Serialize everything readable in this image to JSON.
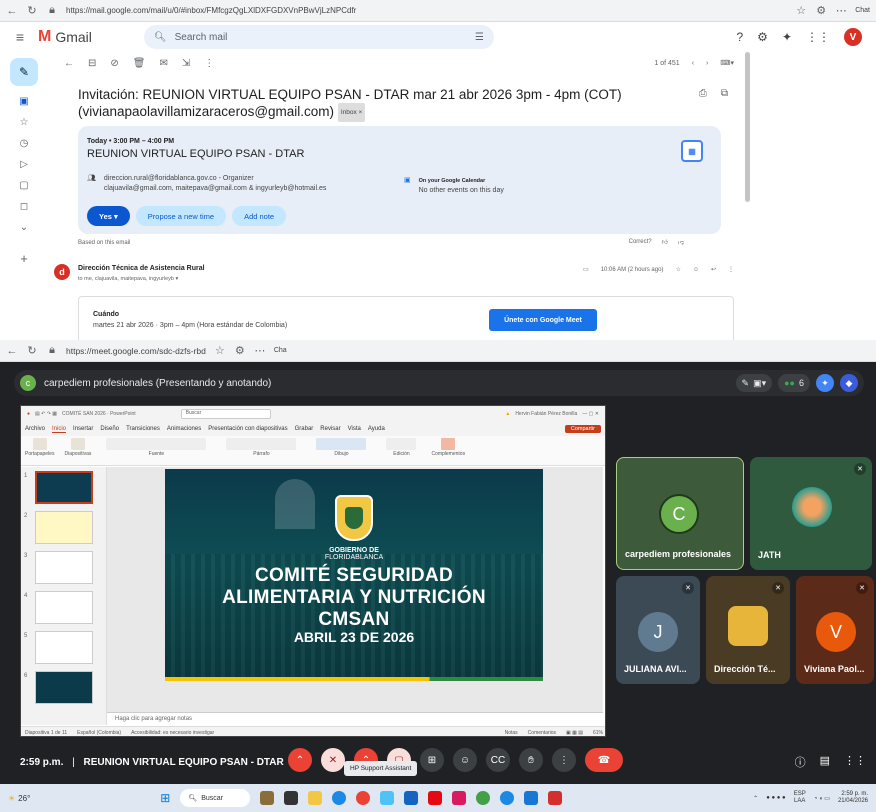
{
  "gmail_browser": {
    "url": "https://mail.google.com/mail/u/0/#inbox/FMfcgzQgLXlDXFGDXVnPBwVjLzNPCdfr",
    "copilot_label": "Chat"
  },
  "gmail": {
    "app_name": "Gmail",
    "search_placeholder": "Search mail",
    "avatar_letter": "V",
    "pager": "1 of 451",
    "subject_line1": "Invitación: REUNION VIRTUAL EQUIPO PSAN - DTAR mar 21 abr 2026 3pm - 4pm (COT)",
    "subject_line2": "(vivianapaolavillamizaraceros@gmail.com)",
    "inbox_chip": "Inbox ×",
    "invite": {
      "when": "Today • 3:00 PM – 4:00 PM",
      "title": "REUNION VIRTUAL EQUIPO PSAN - DTAR",
      "organizer": "direccion.rural@floridablanca.gov.co - Organizer",
      "guests": "clajuavila@gmail.com, maitepava@gmail.com & ingyurleyb@hotmail.es",
      "cal_heading": "On your Google Calendar",
      "cal_status": "No other events on this day",
      "btn_yes": "Yes ▾",
      "btn_propose": "Propose a new time",
      "btn_note": "Add note"
    },
    "based_on": "Based on this email",
    "correct_q": "Correct?",
    "sender": {
      "avatar": "d",
      "name": "Dirección Técnica de Asistencia Rural",
      "to": "to me, clajuavila, maitepava, ingyurleyb ▾",
      "time": "10:06 AM (2 hours ago)"
    },
    "body": {
      "cuando_label": "Cuándo",
      "cuando_value": "martes 21 abr 2026 · 3pm – 4pm (Hora estándar de Colombia)",
      "meet_button": "Únete con Google Meet"
    }
  },
  "meet_browser": {
    "url": "https://meet.google.com/sdc-dzfs-rbd",
    "copilot_label": "Cha"
  },
  "meet": {
    "presenter_avatar": "c",
    "presenter_label": "carpediem profesionales (Presentando y anotando)",
    "participant_count": "6",
    "powerpoint": {
      "title_text": "COMITÉ SAN 2026 · PowerPoint",
      "search": "Buscar",
      "user": "Hervin Fabián Pérez Bonilla",
      "menu": [
        "Archivo",
        "Inicio",
        "Insertar",
        "Diseño",
        "Transiciones",
        "Animaciones",
        "Presentación con diapositivas",
        "Grabar",
        "Revisar",
        "Vista",
        "Ayuda"
      ],
      "share_btn": "Compartir",
      "ribbon_groups": [
        "Portapapeles",
        "Diapositivas",
        "Fuente",
        "Párrafo",
        "Dibujo",
        "Edición",
        "Complementos"
      ],
      "slide_numbers": [
        "1",
        "2",
        "3",
        "4",
        "5",
        "6"
      ],
      "notes_placeholder": "Haga clic para agregar notas",
      "status_left": "Diapositiva 1 de 11",
      "status_lang": "Español (Colombia)",
      "status_access": "Accesibilidad: es necesario investigar",
      "status_notes": "Notas",
      "status_comments": "Comentarios",
      "zoom": "61%"
    },
    "slide": {
      "gobierno": "GOBIERNO DE",
      "floridablanca": "FLORIDABLANCA",
      "line1": "COMITÉ  SEGURIDAD",
      "line2": "ALIMENTARIA Y NUTRICIÓN",
      "line3": "CMSAN",
      "date": "ABRIL 23 DE 2026"
    },
    "tiles": [
      {
        "name": "carpediem profesionales",
        "avatar": "C",
        "color": "#6ab04c"
      },
      {
        "name": "JATH",
        "avatar": "",
        "color": "#2f7a40"
      },
      {
        "name": "JULIANA AVI...",
        "avatar": "J",
        "color": "#607b8f"
      },
      {
        "name": "Dirección Té...",
        "avatar": "",
        "color": "#6b5a3a"
      },
      {
        "name": "Viviana Paol...",
        "avatar": "V",
        "color": "#e8590c"
      }
    ],
    "bottom": {
      "time": "2:59 p.m.",
      "separator": "|",
      "meeting_name": "REUNION VIRTUAL EQUIPO PSAN - DTAR",
      "tooltip": "HP Support Assistant"
    }
  },
  "taskbar": {
    "weather": "26°",
    "search": "Buscar",
    "lang1": "ESP",
    "lang2": "LAA",
    "time": "2:59 p. m.",
    "date": "21/04/2026"
  },
  "colors": {
    "gmail_red": "#ea4335",
    "meet_bg": "#202124",
    "blue_primary": "#0b57d0",
    "end_call": "#ea4335"
  }
}
